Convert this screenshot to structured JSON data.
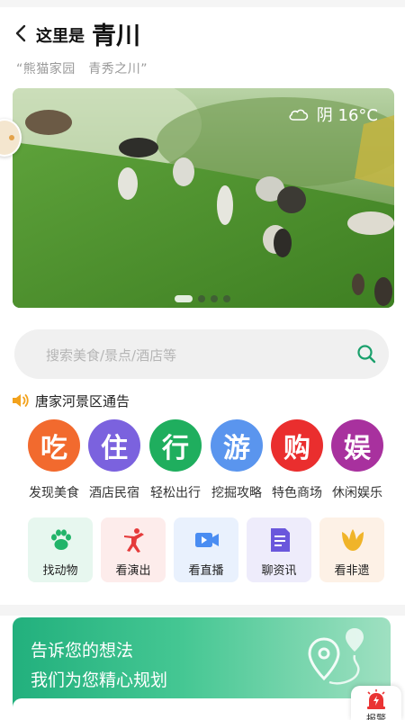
{
  "header": {
    "title_prefix": "这里是",
    "title_main": "青川",
    "slogan": "“熊猫家园　青秀之川”"
  },
  "banner": {
    "weather_text": "阴 16°C",
    "weather_icon": "cloud-icon",
    "slide_count": 4,
    "active_slide": 1
  },
  "search": {
    "placeholder": "搜索美食/景点/酒店等",
    "icon": "search-icon"
  },
  "notice": {
    "icon": "speaker-icon",
    "text": "唐家河景区通告"
  },
  "categories": [
    {
      "glyph": "吃",
      "label": "发现美食",
      "color": "#f26a2e"
    },
    {
      "glyph": "住",
      "label": "酒店民宿",
      "color": "#7b62de"
    },
    {
      "glyph": "行",
      "label": "轻松出行",
      "color": "#1fae5e"
    },
    {
      "glyph": "游",
      "label": "挖掘攻略",
      "color": "#5a95ee"
    },
    {
      "glyph": "购",
      "label": "特色商场",
      "color": "#ea2e2e"
    },
    {
      "glyph": "娱",
      "label": "休闲娱乐",
      "color": "#a8319e"
    }
  ],
  "tiles": [
    {
      "label": "找动物",
      "icon": "paw-icon",
      "bg": "#e7f7ef",
      "color": "#22b46a"
    },
    {
      "label": "看演出",
      "icon": "dancer-icon",
      "bg": "#fdeceb",
      "color": "#e53b3b"
    },
    {
      "label": "看直播",
      "icon": "video-camera-icon",
      "bg": "#e9f1fd",
      "color": "#4a8df2"
    },
    {
      "label": "聊资讯",
      "icon": "document-icon",
      "bg": "#eeecfb",
      "color": "#6a57dc"
    },
    {
      "label": "看非遗",
      "icon": "tulip-icon",
      "bg": "#fdf1e6",
      "color": "#f0b429"
    }
  ],
  "plan_card": {
    "line1": "告诉您的想法",
    "line2": "我们为您精心规划",
    "icon": "route-pin-icon"
  },
  "report_button": {
    "label": "报警",
    "icon": "alarm-icon"
  }
}
